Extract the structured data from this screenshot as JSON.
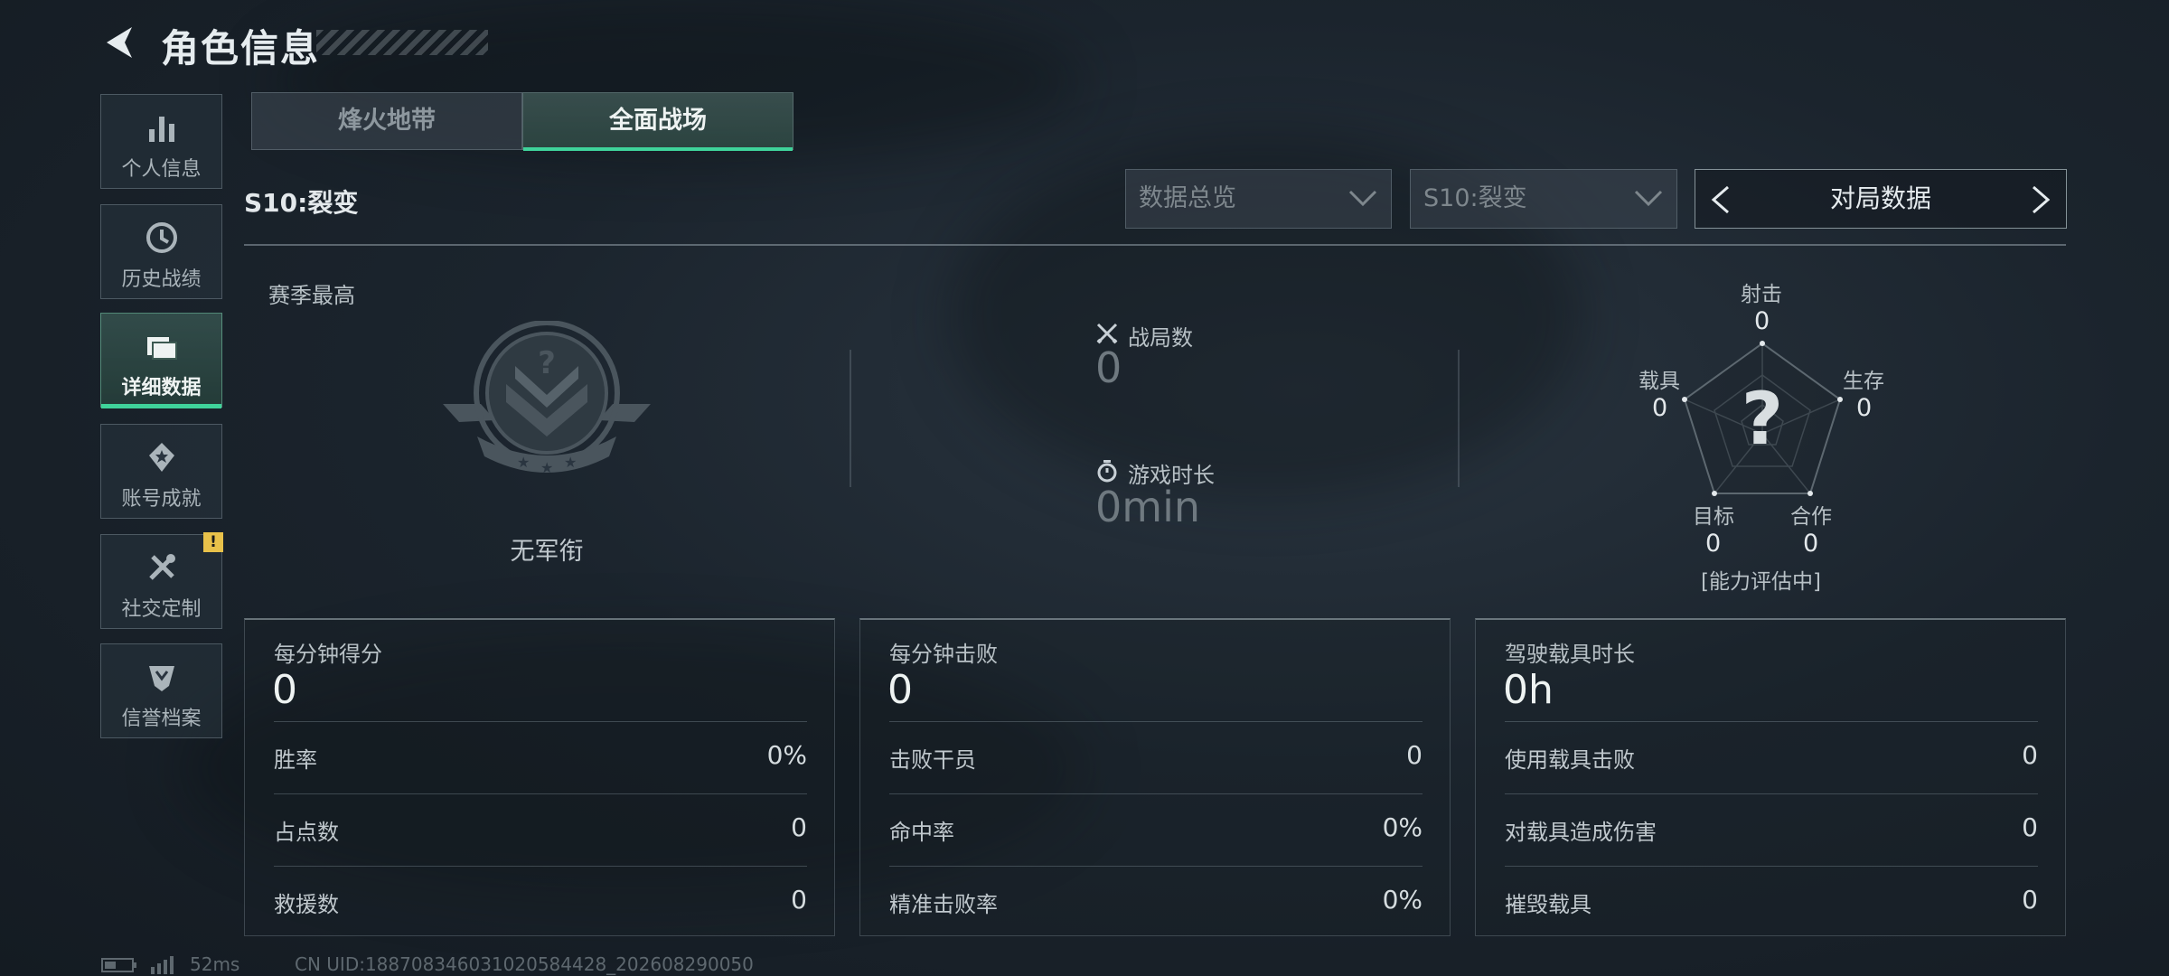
{
  "header": {
    "title": "角色信息"
  },
  "sidebar": {
    "items": [
      {
        "label": "个人信息",
        "icon": "bar-chart-icon"
      },
      {
        "label": "历史战绩",
        "icon": "history-clock-icon"
      },
      {
        "label": "详细数据",
        "icon": "folders-icon",
        "active": true
      },
      {
        "label": "账号成就",
        "icon": "achievement-medal-icon"
      },
      {
        "label": "社交定制",
        "icon": "tools-icon",
        "badge": "!"
      },
      {
        "label": "信誉档案",
        "icon": "credit-shield-icon"
      }
    ]
  },
  "tabs": [
    {
      "label": "烽火地带",
      "active": false
    },
    {
      "label": "全面战场",
      "active": true
    }
  ],
  "toolbar": {
    "season": "S10:裂变",
    "dropdown_overview": "数据总览",
    "dropdown_season": "S10:裂变",
    "pager_label": "对局数据"
  },
  "overview": {
    "season_high_label": "赛季最高",
    "rank_name": "无军衔",
    "matches_label": "战局数",
    "matches_value": "0",
    "playtime_label": "游戏时长",
    "playtime_value": "0min"
  },
  "radar": {
    "center_symbol": "?",
    "status": "[能力评估中]",
    "axes": [
      {
        "label": "射击",
        "value": "0"
      },
      {
        "label": "生存",
        "value": "0"
      },
      {
        "label": "合作",
        "value": "0"
      },
      {
        "label": "目标",
        "value": "0"
      },
      {
        "label": "载具",
        "value": "0"
      }
    ]
  },
  "cards": [
    {
      "title": "每分钟得分",
      "value": "0",
      "rows": [
        {
          "k": "胜率",
          "v": "0%"
        },
        {
          "k": "占点数",
          "v": "0"
        },
        {
          "k": "救援数",
          "v": "0"
        }
      ]
    },
    {
      "title": "每分钟击败",
      "value": "0",
      "rows": [
        {
          "k": "击败干员",
          "v": "0"
        },
        {
          "k": "命中率",
          "v": "0%"
        },
        {
          "k": "精准击败率",
          "v": "0%"
        }
      ]
    },
    {
      "title": "驾驶载具时长",
      "value": "0h",
      "rows": [
        {
          "k": "使用载具击败",
          "v": "0"
        },
        {
          "k": "对载具造成伤害",
          "v": "0"
        },
        {
          "k": "摧毁载具",
          "v": "0"
        }
      ]
    }
  ],
  "footer": {
    "ping": "52ms",
    "uid": "CN UID:18870834603102058442​8_202608290050"
  },
  "colors": {
    "accent": "#3fd39a",
    "warning": "#e8c14a"
  }
}
